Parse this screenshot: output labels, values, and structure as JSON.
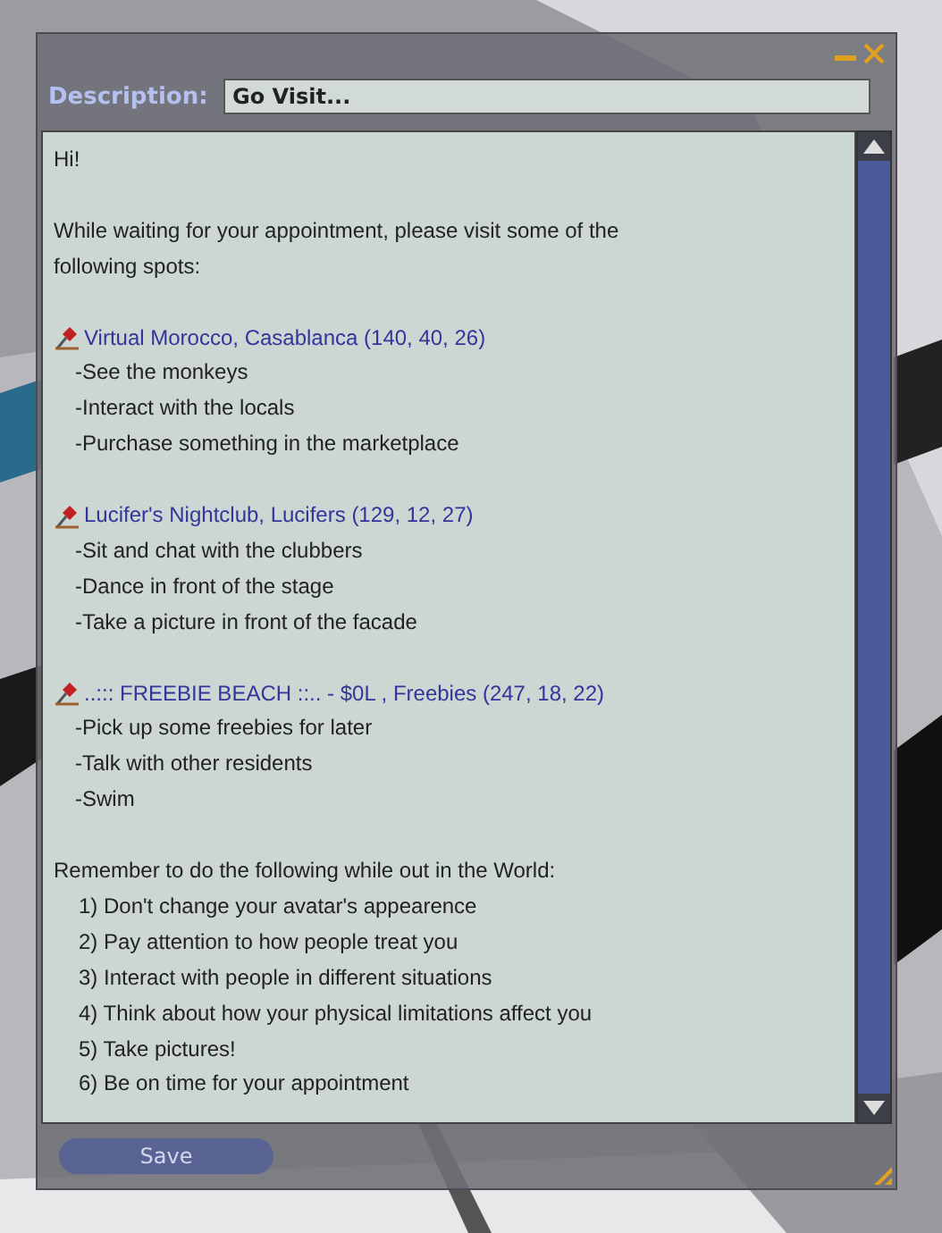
{
  "description": {
    "label": "Description:",
    "value": "Go Visit..."
  },
  "notecard": {
    "greeting": "Hi!",
    "intro": "While waiting for your appointment, please visit some of the following spots:",
    "places": [
      {
        "name": "Virtual Morocco, Casablanca (140, 40, 26)",
        "items": [
          "-See the monkeys",
          "-Interact with the locals",
          "-Purchase something in the marketplace"
        ]
      },
      {
        "name": "Lucifer's Nightclub, Lucifers (129, 12, 27)",
        "items": [
          "-Sit and chat with the clubbers",
          "-Dance in front of the stage",
          "-Take a picture in front of the facade"
        ]
      },
      {
        "name": "..::: FREEBIE BEACH  ::.. - $0L , Freebies (247, 18, 22)",
        "items": [
          "-Pick up some freebies for later",
          "-Talk with other residents",
          "-Swim"
        ]
      }
    ],
    "reminder_intro": "Remember to do the following while out in the World:",
    "reminders": [
      "1) Don't change your avatar's appearence",
      "2) Pay attention to how people treat you",
      "3) Interact with people in different situations",
      "4) Think about how your physical limitations affect you",
      "5) Take pictures!",
      "6) Be on time for your appointment"
    ]
  },
  "save_button": {
    "label": "Save",
    "disabled": true
  }
}
